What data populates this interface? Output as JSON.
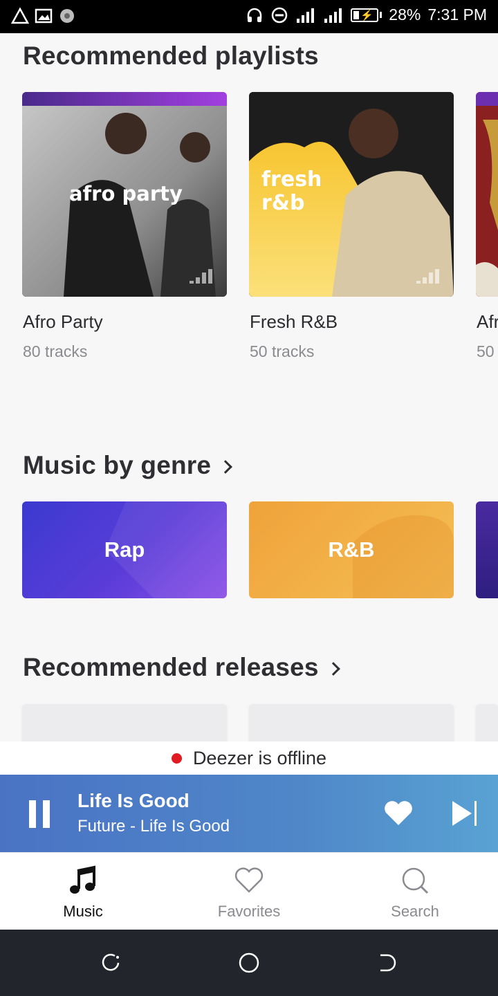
{
  "status_bar": {
    "battery": "28%",
    "time": "7:31 PM"
  },
  "sections": {
    "playlists_title": "Recommended playlists",
    "genre_title": "Music by genre",
    "releases_title": "Recommended releases"
  },
  "playlists": [
    {
      "cover_text": "afro party",
      "title": "Afro Party",
      "subtitle": "80 tracks"
    },
    {
      "cover_text": "fresh r&b",
      "title": "Fresh R&B",
      "subtitle": "50 tracks"
    },
    {
      "cover_text": "",
      "title": "Afr",
      "subtitle": "50"
    }
  ],
  "genres": [
    {
      "label": "Rap"
    },
    {
      "label": "R&B"
    }
  ],
  "offline_banner": {
    "text": "Deezer is offline"
  },
  "player": {
    "title": "Life Is Good",
    "subtitle": "Future - Life Is Good"
  },
  "tabs": [
    {
      "label": "Music",
      "icon": "music-note-icon",
      "active": true
    },
    {
      "label": "Favorites",
      "icon": "heart-outline-icon",
      "active": false
    },
    {
      "label": "Search",
      "icon": "search-icon",
      "active": false
    }
  ],
  "colors": {
    "accent_purple": "#a23fe0",
    "rap_gradient_start": "#3b3ad0",
    "rb_orange": "#f0a23a",
    "offline_dot": "#e01b22",
    "player_blue": "#4f87c9"
  }
}
